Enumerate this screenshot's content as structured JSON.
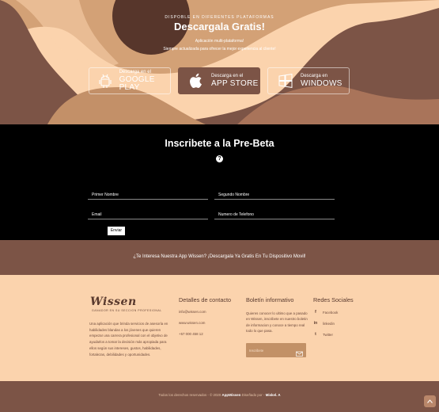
{
  "hero": {
    "eyebrow": "DISPOBLE EN DIFERENTES PLATAFORMAS",
    "title": "Descargala Gratis!",
    "subtitle1": "Aplicación multi-plataforma!",
    "subtitle2": "Siempre actualizada para ofrecer la mejor experiencia al cliente!",
    "stores": [
      {
        "small": "Descarga en el",
        "big": "GOOGLE PLAY",
        "icon": "android-icon"
      },
      {
        "small": "Descarga en el",
        "big": "APP STORE",
        "icon": "apple-icon"
      },
      {
        "small": "Descarga en",
        "big": "WINDOWS",
        "icon": "windows-icon"
      }
    ]
  },
  "prebeta": {
    "title": "Inscribete a la Pre-Beta",
    "fields": {
      "first_name": "Primer Nombre",
      "second_name": "Segundo Nombre",
      "email": "Email",
      "phone": "Numero de Telefono"
    },
    "send_label": "Enviar"
  },
  "promo": {
    "text": "¿Te Interesa Nuestra App Wissen? ¡Descargala Ya Gratis En Tu Dispositivo Movil!"
  },
  "footer": {
    "logo": "Wissen",
    "logo_tagline": "GANADOR EN SU SECCION PROFESIONAL",
    "about": "Una aplicación que brinda servicios de asesoría en habilidades blandas a los jóvenes que quieren empezar una carrera profesional con el objetivo de ayudarlos a tomar la decisión más apropiada para ellos según sus intereses, gustos, habilidades, fortalezas, debilidades y oportunidades.",
    "contact": {
      "title": "Detalles de contacto",
      "email": "info@wissen.com",
      "web": "www.wissen.com",
      "phone": "+57 000 458 12"
    },
    "newsletter": {
      "title": "Boletín informativo",
      "text": "Quieres conocer lo ultimo que a pasado en Wissen, inscribete en nuestro boletin de informacion y conoce a tiempo real todo lo que pasa.",
      "placeholder": "Inscribete"
    },
    "social": {
      "title": "Redes Sociales",
      "items": [
        {
          "label": "Facebook",
          "icon": "f"
        },
        {
          "label": "linkedin",
          "icon": "in"
        },
        {
          "label": "Twitter",
          "icon": "t"
        }
      ]
    }
  },
  "bottom": {
    "copy_prefix": "Todos los derechos reservados - © 2020",
    "copy_brand": "AppWissen",
    "copy_mid": "Diseñado por -",
    "copy_author": "Miskel. A"
  },
  "colors": {
    "peach": "#fbd3ad",
    "brown": "#7c5446",
    "dark_brown": "#5a3a2e",
    "black": "#000000"
  }
}
